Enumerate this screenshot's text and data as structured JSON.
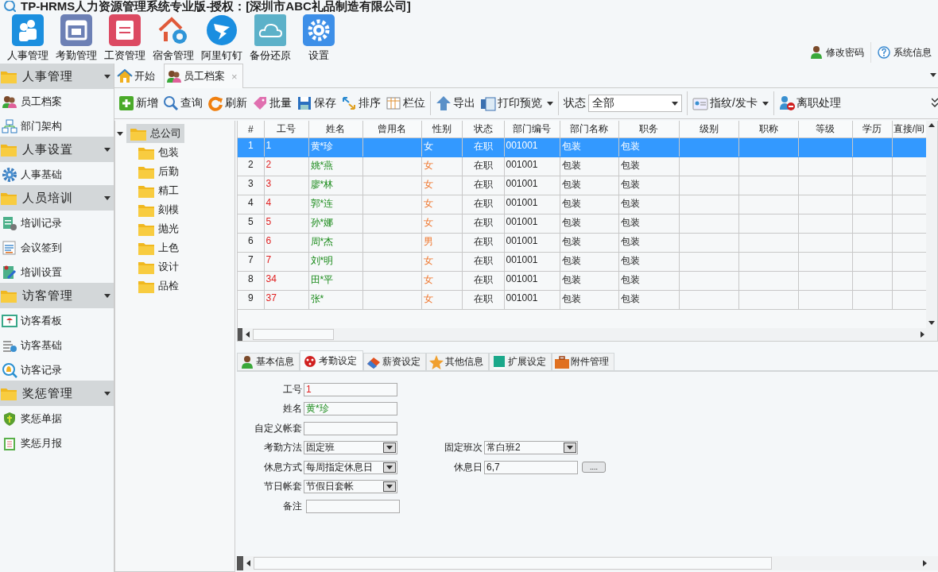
{
  "window": {
    "title": "TP-HRMS人力资源管理系统专业版-授权：[深圳市ABC礼品制造有限公司]"
  },
  "app_buttons": [
    {
      "label": "人事管理"
    },
    {
      "label": "考勤管理"
    },
    {
      "label": "工资管理"
    },
    {
      "label": "宿舍管理"
    },
    {
      "label": "阿里钉钉"
    },
    {
      "label": "备份还原"
    },
    {
      "label": "设置"
    }
  ],
  "header_links": [
    {
      "label": "修改密码"
    },
    {
      "label": "系统信息"
    }
  ],
  "sidebar": {
    "groups": [
      {
        "title": "人事管理",
        "items": [
          {
            "label": "员工档案"
          },
          {
            "label": "部门架构"
          }
        ]
      },
      {
        "title": "人事设置",
        "items": [
          {
            "label": "人事基础"
          }
        ]
      },
      {
        "title": "人员培训",
        "items": [
          {
            "label": "培训记录"
          },
          {
            "label": "会议签到"
          },
          {
            "label": "培训设置"
          }
        ]
      },
      {
        "title": "访客管理",
        "items": [
          {
            "label": "访客看板"
          },
          {
            "label": "访客基础"
          },
          {
            "label": "访客记录"
          }
        ]
      },
      {
        "title": "奖惩管理",
        "items": [
          {
            "label": "奖惩单据"
          },
          {
            "label": "奖惩月报"
          }
        ]
      }
    ]
  },
  "tabs": [
    {
      "label": "开始",
      "selected": false
    },
    {
      "label": "员工档案",
      "selected": true,
      "close": "×"
    }
  ],
  "toolbar": [
    {
      "kind": "button",
      "label": "新增"
    },
    {
      "kind": "button",
      "label": "查询"
    },
    {
      "kind": "button",
      "label": "刷新"
    },
    {
      "kind": "button",
      "label": "批量"
    },
    {
      "kind": "button",
      "label": "保存"
    },
    {
      "kind": "button",
      "label": "排序"
    },
    {
      "kind": "button",
      "label": "栏位"
    },
    {
      "kind": "divider"
    },
    {
      "kind": "button",
      "label": "导出"
    },
    {
      "kind": "menu",
      "label": "打印预览"
    },
    {
      "kind": "divider"
    },
    {
      "kind": "select",
      "label": "状态",
      "value": "全部"
    },
    {
      "kind": "divider"
    },
    {
      "kind": "menu",
      "label": "指纹/发卡"
    },
    {
      "kind": "divider"
    },
    {
      "kind": "button",
      "label": "离职处理"
    }
  ],
  "tree": {
    "label": "总公司",
    "expanded": true,
    "selected": true,
    "children": [
      {
        "label": "包装"
      },
      {
        "label": "后勤"
      },
      {
        "label": "精工"
      },
      {
        "label": "刻模"
      },
      {
        "label": "抛光"
      },
      {
        "label": "上色"
      },
      {
        "label": "设计"
      },
      {
        "label": "品检"
      }
    ]
  },
  "table": {
    "columns": [
      "#",
      "工号",
      "姓名",
      "曾用名",
      "性别",
      "状态",
      "部门编号",
      "部门名称",
      "职务",
      "级别",
      "职称",
      "等级",
      "学历",
      "直接/间"
    ],
    "rows": [
      {
        "selected": true,
        "cells": [
          "1",
          "1",
          "黄*珍",
          null,
          "女",
          "在职",
          "001001",
          "包装",
          "包装"
        ]
      },
      {
        "selected": false,
        "cells": [
          "2",
          "2",
          "姚*燕",
          null,
          "女",
          "在职",
          "001001",
          "包装",
          "包装"
        ]
      },
      {
        "selected": false,
        "cells": [
          "3",
          "3",
          "廖*林",
          null,
          "女",
          "在职",
          "001001",
          "包装",
          "包装"
        ]
      },
      {
        "selected": false,
        "cells": [
          "4",
          "4",
          "郭*连",
          null,
          "女",
          "在职",
          "001001",
          "包装",
          "包装"
        ]
      },
      {
        "selected": false,
        "cells": [
          "5",
          "5",
          "孙*娜",
          null,
          "女",
          "在职",
          "001001",
          "包装",
          "包装"
        ]
      },
      {
        "selected": false,
        "cells": [
          "6",
          "6",
          "周*杰",
          null,
          "男",
          "在职",
          "001001",
          "包装",
          "包装"
        ]
      },
      {
        "selected": false,
        "cells": [
          "7",
          "7",
          "刘*明",
          null,
          "女",
          "在职",
          "001001",
          "包装",
          "包装"
        ]
      },
      {
        "selected": false,
        "cells": [
          "8",
          "34",
          "田*平",
          null,
          "女",
          "在职",
          "001001",
          "包装",
          "包装"
        ]
      },
      {
        "selected": false,
        "cells": [
          "9",
          "37",
          "张*",
          null,
          "女",
          "在职",
          "001001",
          "包装",
          "包装"
        ]
      }
    ]
  },
  "detail_tabs": [
    {
      "label": "基本信息",
      "selected": false
    },
    {
      "label": "考勤设定",
      "selected": true
    },
    {
      "label": "薪资设定",
      "selected": false
    },
    {
      "label": "其他信息",
      "selected": false
    },
    {
      "label": "扩展设定",
      "selected": false
    },
    {
      "label": "附件管理",
      "selected": false
    }
  ],
  "form": [
    [
      {
        "label": "工号",
        "value": "1",
        "kind": "text"
      }
    ],
    [
      {
        "label": "姓名",
        "value": "黄*珍",
        "kind": "text"
      }
    ],
    [
      {
        "label": "自定义帐套",
        "kind": "text"
      }
    ],
    [
      {
        "label": "考勤方法",
        "value": "固定班",
        "kind": "select"
      },
      {
        "label": "固定班次",
        "value": "常白班2",
        "kind": "select"
      }
    ],
    [
      {
        "label": "休息方式",
        "value": "每周指定休息日",
        "kind": "select"
      },
      {
        "label": "休息日",
        "value": "6,7",
        "kind": "text",
        "button": "...."
      }
    ],
    [
      {
        "label": "节日帐套",
        "value": "节假日套帐",
        "kind": "select"
      }
    ],
    [
      {
        "label": "备注",
        "kind": "text"
      }
    ]
  ]
}
